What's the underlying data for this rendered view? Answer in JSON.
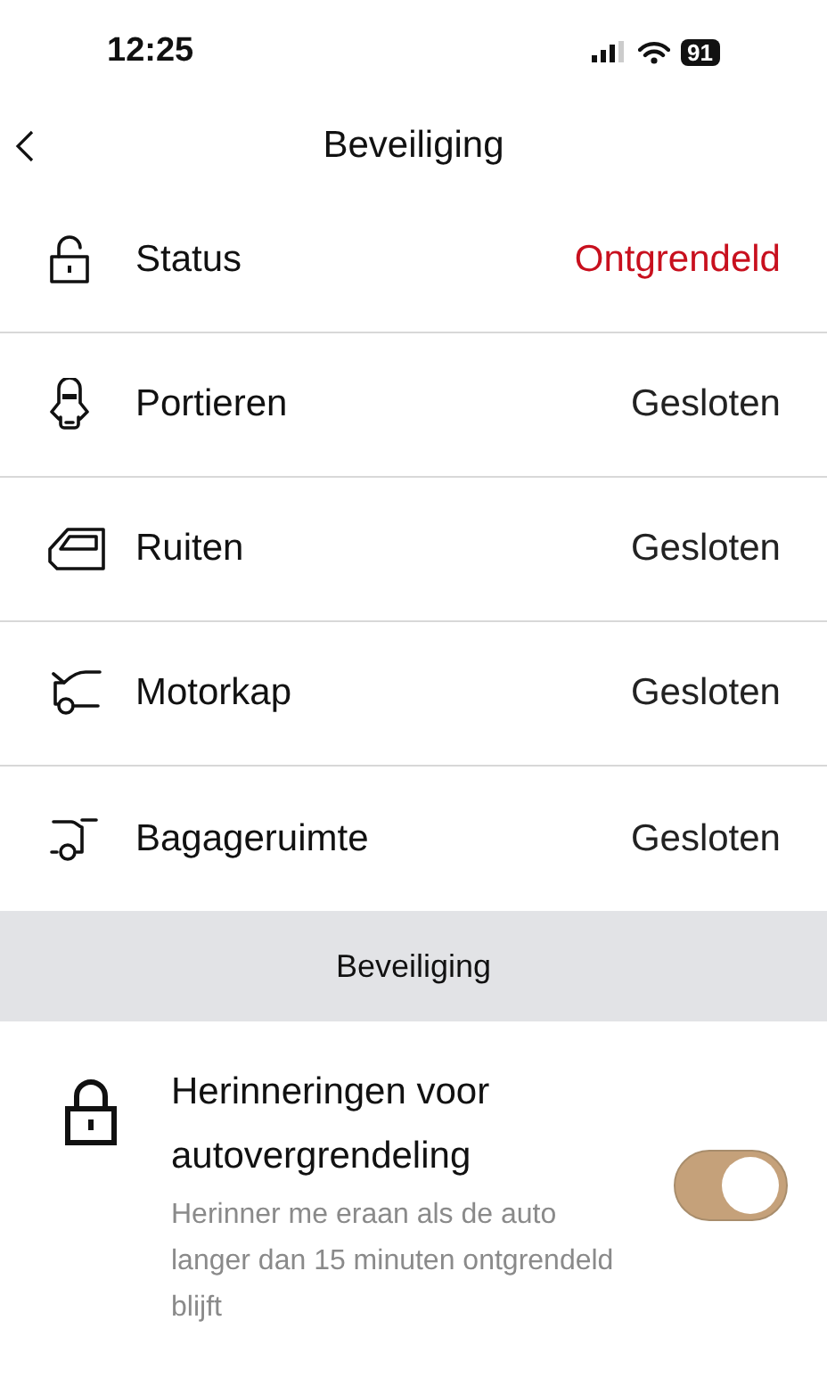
{
  "status_bar": {
    "time": "12:25",
    "battery": "91"
  },
  "header": {
    "title": "Beveiliging"
  },
  "rows": [
    {
      "kind": "lock",
      "label": "Status",
      "value": "Ontgrendeld",
      "warning": true
    },
    {
      "kind": "doors",
      "label": "Portieren",
      "value": "Gesloten",
      "warning": false
    },
    {
      "kind": "window",
      "label": "Ruiten",
      "value": "Gesloten",
      "warning": false
    },
    {
      "kind": "hood",
      "label": "Motorkap",
      "value": "Gesloten",
      "warning": false
    },
    {
      "kind": "trunk",
      "label": "Bagageruimte",
      "value": "Gesloten",
      "warning": false
    }
  ],
  "section": {
    "title": "Beveiliging"
  },
  "setting": {
    "title": "Herinneringen voor autovergrendeling",
    "description": "Herinner me eraan als de auto langer dan 15 minuten ontgrendeld blijft",
    "on": true
  }
}
